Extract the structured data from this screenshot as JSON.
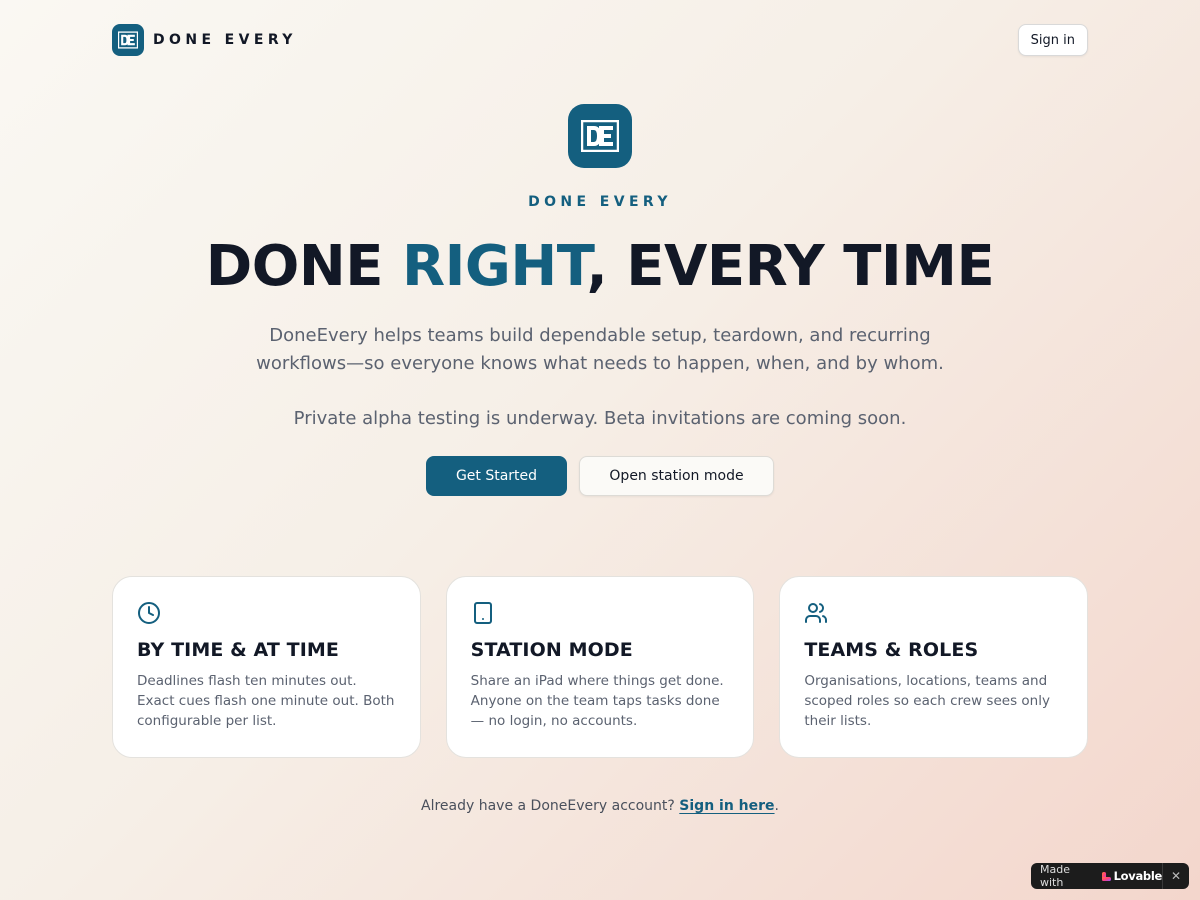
{
  "header": {
    "brand_name": "DONE EVERY",
    "sign_in_label": "Sign in"
  },
  "hero": {
    "eyebrow": "DONE EVERY",
    "headline_part1": "DONE ",
    "headline_accent": "RIGHT",
    "headline_part2": ", EVERY TIME",
    "lede_line1": "DoneEvery helps teams build dependable setup, teardown, and recurring",
    "lede_line2": "workflows—so everyone knows what needs to happen, when, and by whom.",
    "note": "Private alpha testing is underway. Beta invitations are coming soon.",
    "primary_cta": "Get Started",
    "secondary_cta": "Open station mode"
  },
  "features": [
    {
      "icon": "clock-icon",
      "title": "BY TIME & AT TIME",
      "body": "Deadlines flash ten minutes out. Exact cues flash one minute out. Both configurable per list."
    },
    {
      "icon": "tablet-icon",
      "title": "STATION MODE",
      "body": "Share an iPad where things get done. Anyone on the team taps tasks done — no login, no accounts."
    },
    {
      "icon": "users-icon",
      "title": "TEAMS & ROLES",
      "body": "Organisations, locations, teams and scoped roles so each crew sees only their lists."
    }
  ],
  "footer": {
    "prompt": "Already have a DoneEvery account? ",
    "link": "Sign in here",
    "period": "."
  },
  "badge": {
    "made_with": "Made with",
    "brand": "Lovable",
    "close": "✕"
  },
  "colors": {
    "brand": "#145f7f",
    "text": "#121826",
    "muted": "#5b6270"
  }
}
